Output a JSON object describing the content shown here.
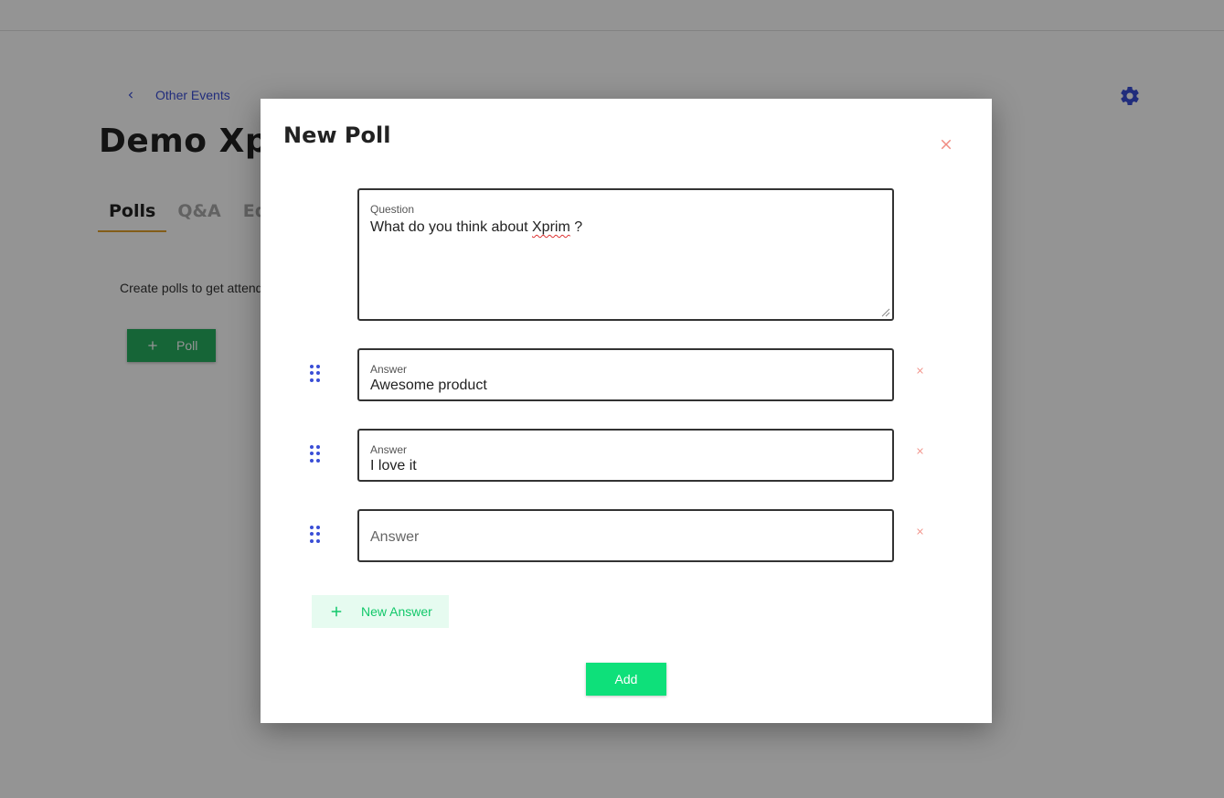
{
  "background": {
    "back_link_label": "Other Events",
    "event_title": "Demo Xprim",
    "tabs": [
      {
        "label": "Polls"
      },
      {
        "label": "Q&A"
      },
      {
        "label": "Ed"
      }
    ],
    "empty_state_text": "Create polls to get attend",
    "poll_button_label": "Poll"
  },
  "modal": {
    "title": "New Poll",
    "question": {
      "label": "Question",
      "value_before": "What do you think about ",
      "value_misspelled": "Xprim",
      "value_after": " ?"
    },
    "answers": [
      {
        "label": "Answer",
        "value": "Awesome product"
      },
      {
        "label": "Answer",
        "value": "I love it"
      },
      {
        "placeholder": "Answer",
        "value": ""
      }
    ],
    "new_answer_label": "New Answer",
    "submit_label": "Add"
  },
  "colors": {
    "primary_blue": "#3a4ed6",
    "accent_green": "#12c86a",
    "remove_red": "#f08a80",
    "tab_underline": "#e2a12c"
  },
  "icons": [
    "chevron-left-icon",
    "gear-icon",
    "plus-icon",
    "close-icon",
    "drag-handle-icon",
    "remove-icon"
  ]
}
